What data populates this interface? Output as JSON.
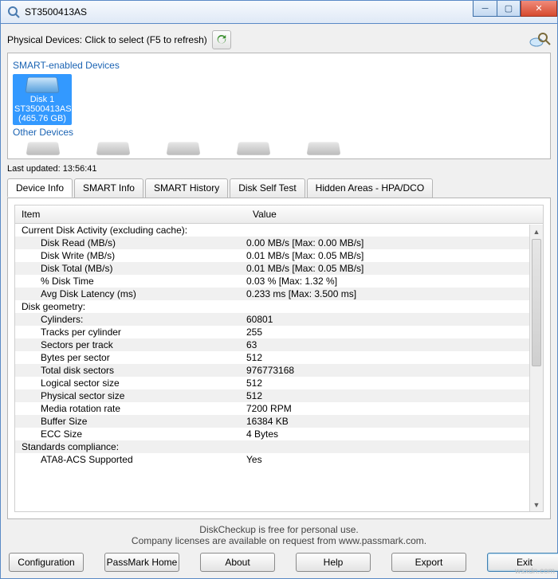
{
  "window": {
    "title": "ST3500413AS"
  },
  "top": {
    "physical_devices_label": "Physical Devices: Click to select (F5 to refresh)"
  },
  "devices": {
    "smart_header": "SMART-enabled Devices",
    "other_header": "Other Devices",
    "selected": {
      "name": "Disk 1",
      "model": "ST3500413AS",
      "capacity": "(465.76 GB)"
    }
  },
  "last_updated": "Last updated: 13:56:41",
  "tabs": [
    {
      "label": "Device Info",
      "active": true
    },
    {
      "label": "SMART Info"
    },
    {
      "label": "SMART History"
    },
    {
      "label": "Disk Self Test"
    },
    {
      "label": "Hidden Areas - HPA/DCO"
    }
  ],
  "table": {
    "col_item": "Item",
    "col_value": "Value",
    "rows": [
      {
        "item": "Current Disk Activity (excluding cache):",
        "value": "",
        "group": true
      },
      {
        "item": "Disk Read (MB/s)",
        "value": "0.00 MB/s   [Max: 0.00 MB/s]",
        "ind": true
      },
      {
        "item": "Disk Write (MB/s)",
        "value": "0.01 MB/s   [Max: 0.05 MB/s]",
        "ind": true
      },
      {
        "item": "Disk Total (MB/s)",
        "value": "0.01 MB/s   [Max: 0.05 MB/s]",
        "ind": true
      },
      {
        "item": "% Disk Time",
        "value": "0.03 %      [Max: 1.32 %]",
        "ind": true
      },
      {
        "item": "Avg Disk Latency (ms)",
        "value": "0.233 ms   [Max: 3.500 ms]",
        "ind": true
      },
      {
        "item": "Disk geometry:",
        "value": "",
        "group": true
      },
      {
        "item": "Cylinders:",
        "value": "60801",
        "ind": true
      },
      {
        "item": "Tracks per cylinder",
        "value": "255",
        "ind": true
      },
      {
        "item": "Sectors per track",
        "value": "63",
        "ind": true
      },
      {
        "item": "Bytes per sector",
        "value": "512",
        "ind": true
      },
      {
        "item": "Total disk sectors",
        "value": "976773168",
        "ind": true
      },
      {
        "item": "Logical sector size",
        "value": "512",
        "ind": true
      },
      {
        "item": "Physical sector size",
        "value": "512",
        "ind": true
      },
      {
        "item": "Media rotation rate",
        "value": "7200 RPM",
        "ind": true
      },
      {
        "item": "Buffer Size",
        "value": "16384 KB",
        "ind": true
      },
      {
        "item": "ECC Size",
        "value": "4 Bytes",
        "ind": true
      },
      {
        "item": "Standards compliance:",
        "value": "",
        "group": true
      },
      {
        "item": "ATA8-ACS Supported",
        "value": "Yes",
        "ind": true
      }
    ]
  },
  "footer": {
    "line1": "DiskCheckup is free for personal use.",
    "line2": "Company licenses are available on request from www.passmark.com."
  },
  "buttons": {
    "configuration": "Configuration",
    "passmark_home": "PassMark Home",
    "about": "About",
    "help": "Help",
    "export": "Export",
    "exit": "Exit"
  },
  "watermark": "wsxdn.com"
}
